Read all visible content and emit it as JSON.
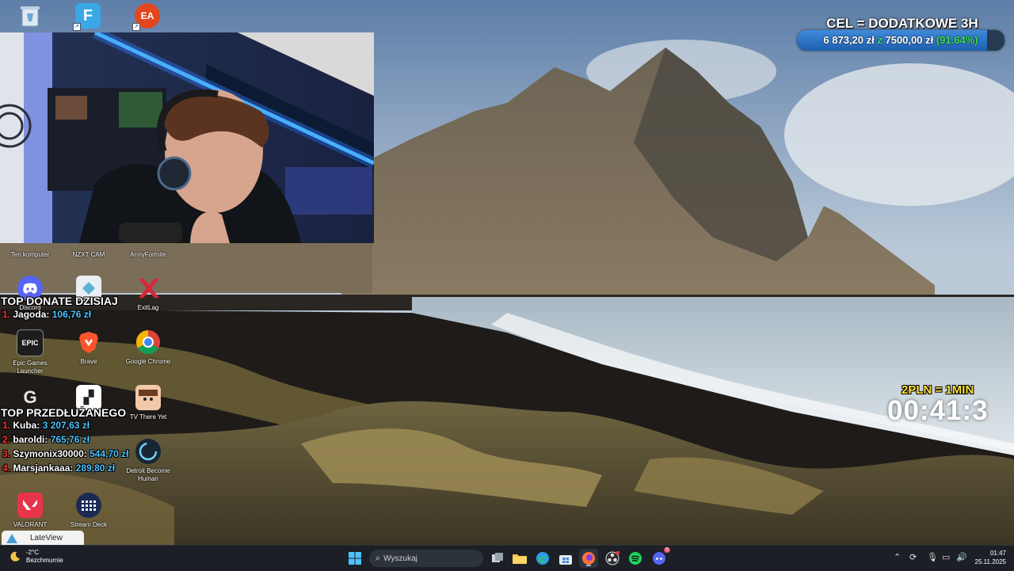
{
  "goal": {
    "title": "CEL = DODATKOWE 3H",
    "current": "6 873,20 zł",
    "sep": "z",
    "target": "7500,00 zł",
    "percent_text": "(91.64%)",
    "percent": 91.64,
    "accent": "#3fe053"
  },
  "top_donate": {
    "title": "TOP DONATE DZISIAJ",
    "rows": [
      {
        "num": "1.",
        "name": "Jagoda:",
        "amount": "106,76 zł"
      }
    ]
  },
  "top_extend": {
    "title": "TOP PRZEDŁUŻANEGO",
    "rows": [
      {
        "num": "1.",
        "name": "Kuba:",
        "amount": "3 207,63 zł"
      },
      {
        "num": "2.",
        "name": "baroldi:",
        "amount": "765,76 zł"
      },
      {
        "num": "3.",
        "name": "Szymonix30000:",
        "amount": "544,70 zł"
      },
      {
        "num": "4.",
        "name": "Marsjankaaa:",
        "amount": "289,80 zł"
      }
    ]
  },
  "timer": {
    "rate": "2PLN = 1MIN",
    "value": "00:41:3"
  },
  "desktop_icons": {
    "ten_komputer": "Ten komputer",
    "nzxt_cam": "NZXT CAM",
    "army_fortnite": "ArmyFortnite",
    "discord": "Discord",
    "exitlag": "ExitLag",
    "epic_games": "Epic Games Launcher",
    "brave": "Brave",
    "chrome": "Google Chrome",
    "they_are_there_yet": "TV There Yet",
    "detroit": "Detroit Become Human",
    "valorant": "VALORANT",
    "stream_deck": "Stream Deck"
  },
  "lateview": {
    "label": "LateView"
  },
  "taskbar": {
    "search_placeholder": "Wyszukaj",
    "weather_temp": "-2°C",
    "weather_desc": "Bezchmurnie",
    "time": "01:47",
    "date": "25.11.2025",
    "discord_badge": "5"
  },
  "colors": {
    "taskbar": "#1c2026",
    "donate_number": "#ff3030",
    "amount": "#4fc3ff",
    "timer_rate": "#ffe23a"
  }
}
